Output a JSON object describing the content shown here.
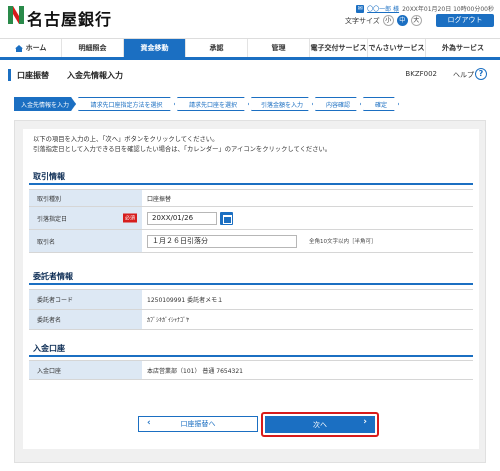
{
  "header": {
    "bank_name": "名古屋銀行",
    "user_name": "〇〇一郎 様",
    "last_login": "20XX年01月20日 10時00分00秒",
    "font_size_label": "文字サイズ",
    "font_sizes": [
      "小",
      "中",
      "大"
    ],
    "logout_label": "ログアウト"
  },
  "nav": {
    "items": [
      "ホーム",
      "明細照会",
      "資金移動",
      "承認",
      "管理",
      "電子交付サービス",
      "でんさいサービス",
      "外為サービス"
    ],
    "active_index": 2
  },
  "page": {
    "category": "口座振替",
    "title": "入金先情報入力",
    "screen_id": "BKZF002",
    "help_label": "ヘルプ"
  },
  "steps": [
    "入金先情報を入力",
    "請求先口座指定方法を選択",
    "請求先口座を選択",
    "引落金額を入力",
    "内容確認",
    "確定"
  ],
  "intro": {
    "line1": "以下の項目を入力の上、「次へ」ボタンをクリックしてください。",
    "line2": "引落指定日として入力できる日を確認したい場合は、「カレンダー」のアイコンをクリックしてください。"
  },
  "transaction": {
    "heading": "取引情報",
    "type_label": "取引種別",
    "type_value": "口座振替",
    "date_label": "引落指定日",
    "required": "必須",
    "date_value": "20XX/01/26",
    "name_label": "取引名",
    "name_value": "１月２６日引落分",
    "name_note": "全角10文字以内［半角可］"
  },
  "consignor": {
    "heading": "委託者情報",
    "code_label": "委託者コード",
    "code_value": "1250109991 委託者メモ１",
    "name_label": "委託者名",
    "name_value": "ｶﾌﾞｼｷｶﾞｲｼｬﾅｺﾞﾔ"
  },
  "deposit": {
    "heading": "入金口座",
    "account_label": "入金口座",
    "account_value": "本店営業部（101） 普通 7654321"
  },
  "buttons": {
    "back": "口座振替へ",
    "next": "次へ"
  },
  "colors": {
    "accent": "#1b6fc2",
    "header_cell": "#dde8f4",
    "required": "#d71d1d",
    "highlight_ring": "#d81b1b"
  }
}
